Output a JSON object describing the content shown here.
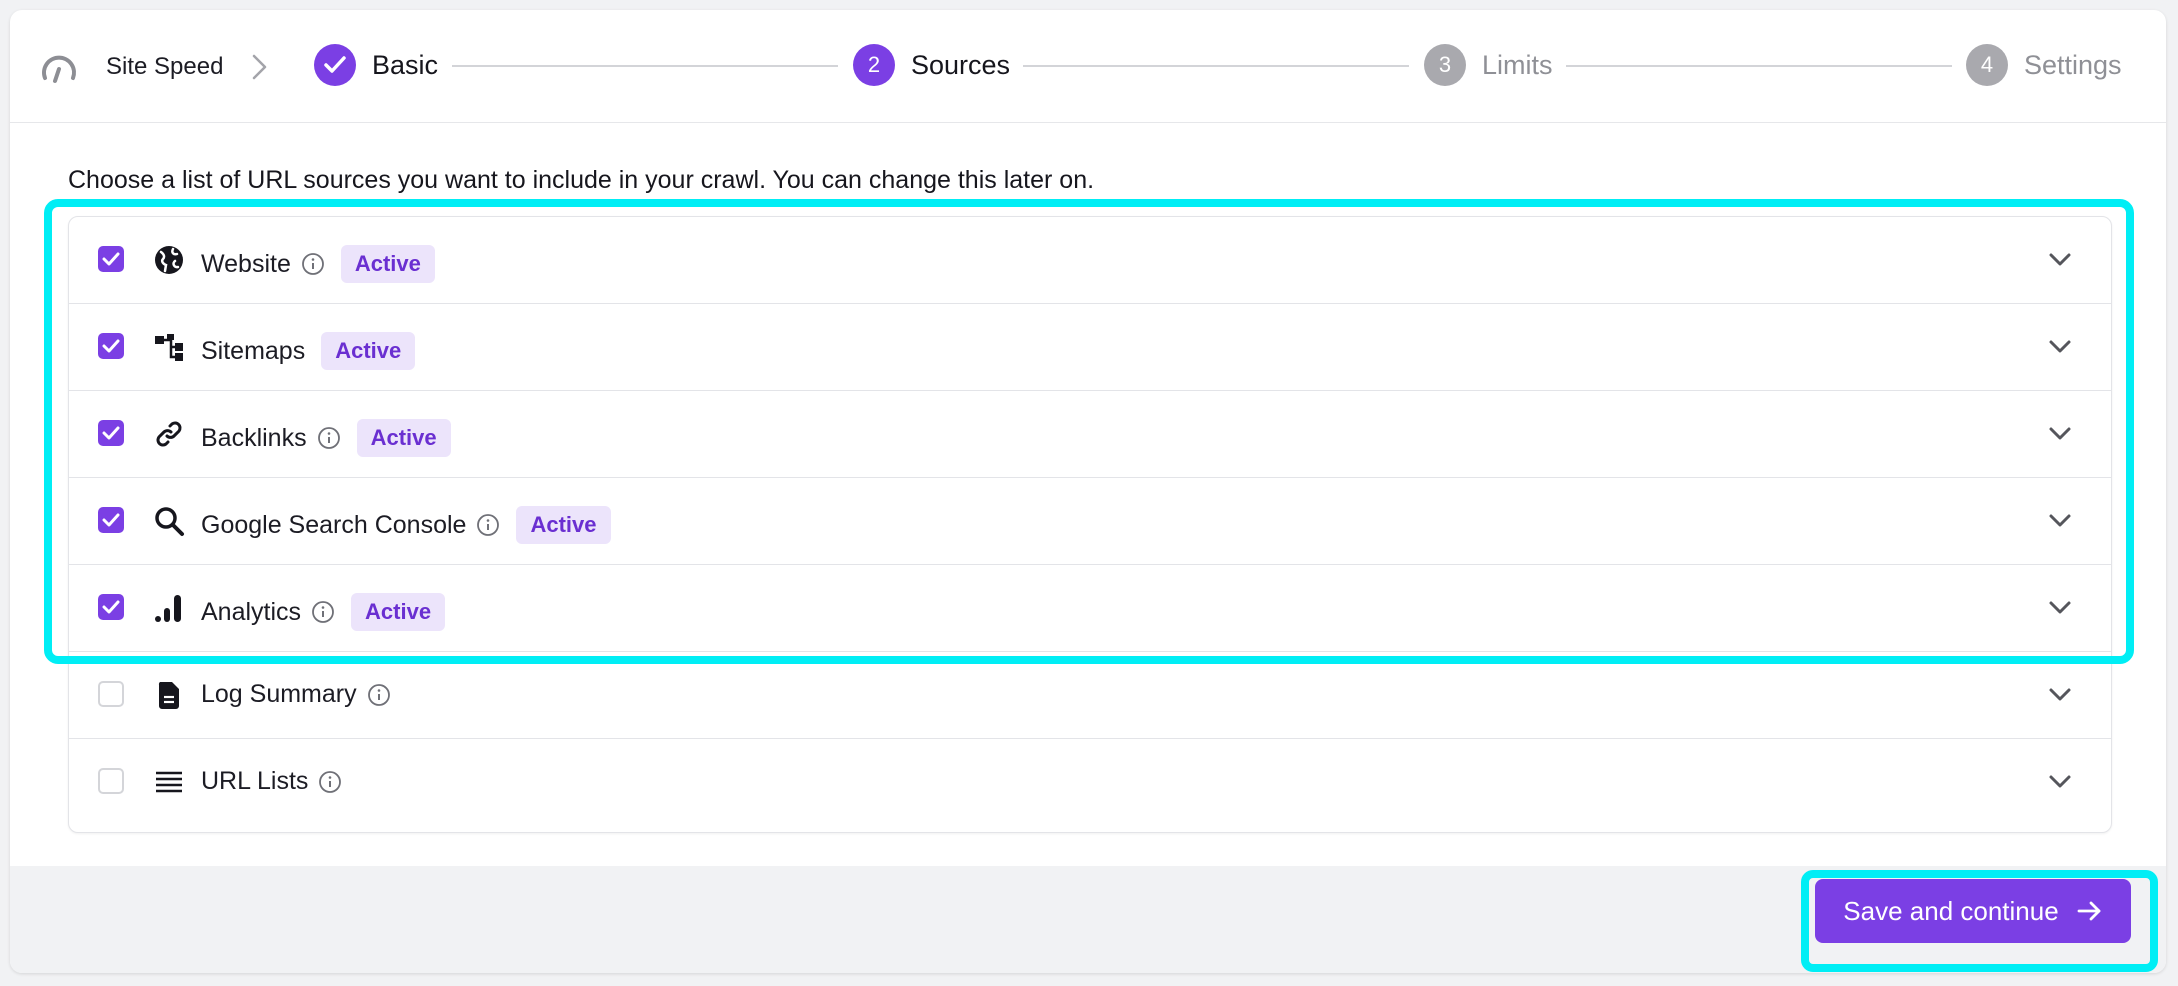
{
  "breadcrumb": {
    "root_label": "Site Speed",
    "root_icon": "gauge-icon",
    "separator_icon": "chevron-right-icon"
  },
  "stepper": {
    "steps": [
      {
        "number": "1",
        "label": "Basic",
        "state": "done"
      },
      {
        "number": "2",
        "label": "Sources",
        "state": "current"
      },
      {
        "number": "3",
        "label": "Limits",
        "state": "todo"
      },
      {
        "number": "4",
        "label": "Settings",
        "state": "todo"
      }
    ]
  },
  "intro_text": "Choose a list of URL sources you want to include in your crawl. You can change this later on.",
  "sources": [
    {
      "label": "Website",
      "icon": "globe-icon",
      "checked": true,
      "info": true,
      "badge": "Active"
    },
    {
      "label": "Sitemaps",
      "icon": "sitemap-icon",
      "checked": true,
      "info": false,
      "badge": "Active"
    },
    {
      "label": "Backlinks",
      "icon": "link-icon",
      "checked": true,
      "info": true,
      "badge": "Active"
    },
    {
      "label": "Google Search Console",
      "icon": "search-icon",
      "checked": true,
      "info": true,
      "badge": "Active"
    },
    {
      "label": "Analytics",
      "icon": "analytics-icon",
      "checked": true,
      "info": true,
      "badge": "Active"
    },
    {
      "label": "Log Summary",
      "icon": "document-icon",
      "checked": false,
      "info": true,
      "badge": ""
    },
    {
      "label": "URL Lists",
      "icon": "list-icon",
      "checked": false,
      "info": true,
      "badge": ""
    }
  ],
  "footer": {
    "save_label": "Save and continue",
    "save_icon": "arrow-right-icon"
  },
  "colors": {
    "accent": "#7b3fe4",
    "badge_bg": "#ece4fb",
    "badge_text": "#6a2fd1",
    "highlight": "#00eef5"
  }
}
